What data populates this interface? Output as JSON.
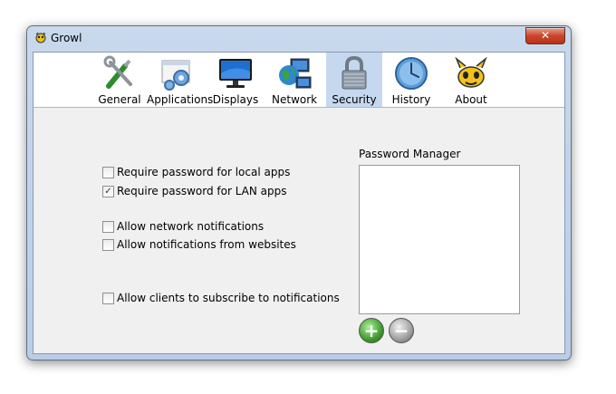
{
  "window": {
    "title": "Growl",
    "close_glyph": "✕"
  },
  "toolbar": {
    "tabs": [
      {
        "label": "General",
        "icon": "tools-icon"
      },
      {
        "label": "Applications",
        "icon": "applications-icon"
      },
      {
        "label": "Displays",
        "icon": "monitor-icon"
      },
      {
        "label": "Network",
        "icon": "network-icon"
      },
      {
        "label": "Security",
        "icon": "padlock-icon",
        "selected": true
      },
      {
        "label": "History",
        "icon": "clock-icon"
      },
      {
        "label": "About",
        "icon": "growl-logo-icon"
      }
    ]
  },
  "security": {
    "options": [
      {
        "label": "Require password for local apps",
        "checked": false
      },
      {
        "label": "Require password for LAN apps",
        "checked": true
      },
      {
        "label": "Allow network notifications",
        "checked": false
      },
      {
        "label": "Allow notifications from websites",
        "checked": false
      },
      {
        "label": "Allow clients to subscribe to notifications",
        "checked": false
      }
    ],
    "check_glyph": "✓",
    "password_manager": {
      "label": "Password Manager",
      "add_glyph": "+",
      "remove_glyph": "−"
    }
  }
}
